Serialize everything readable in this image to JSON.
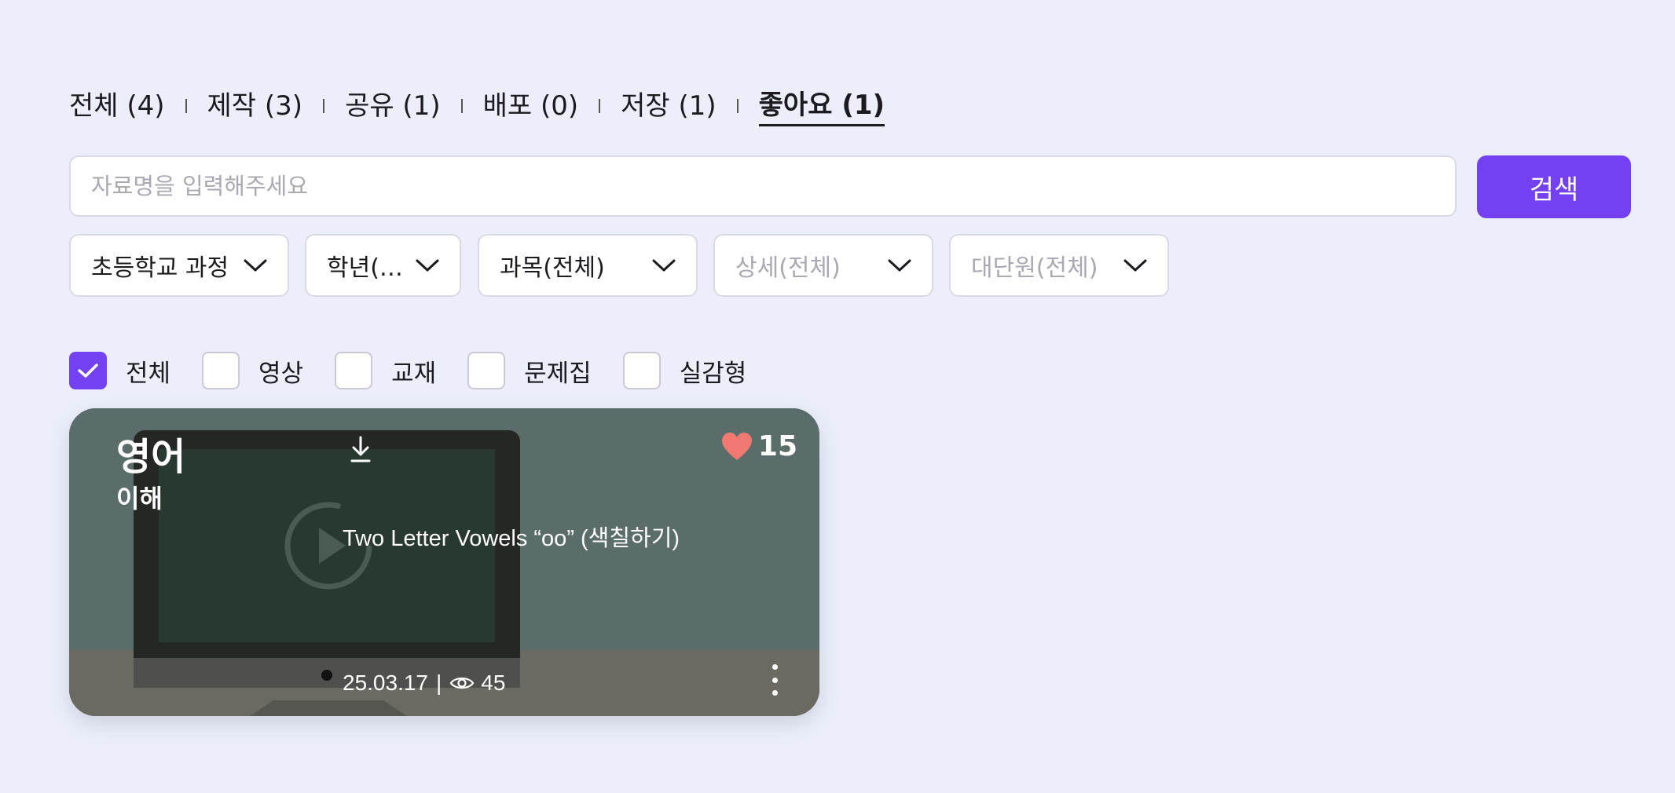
{
  "tabs": [
    {
      "label": "전체 (4)",
      "active": false
    },
    {
      "label": "제작 (3)",
      "active": false
    },
    {
      "label": "공유 (1)",
      "active": false
    },
    {
      "label": "배포 (0)",
      "active": false
    },
    {
      "label": "저장 (1)",
      "active": false
    },
    {
      "label": "좋아요 (1)",
      "active": true
    }
  ],
  "search": {
    "placeholder": "자료명을 입력해주세요",
    "value": "",
    "button_label": "검색"
  },
  "filters": {
    "course": "초등학교 과정",
    "grade": "학년(…",
    "subject": "과목(전체)",
    "detail": "상세(전체)",
    "unit": "대단원(전체)"
  },
  "checkboxes": [
    {
      "label": "전체",
      "checked": true
    },
    {
      "label": "영상",
      "checked": false
    },
    {
      "label": "교재",
      "checked": false
    },
    {
      "label": "문제집",
      "checked": false
    },
    {
      "label": "실감형",
      "checked": false
    }
  ],
  "card": {
    "subject": "영어",
    "topic": "이해",
    "likes": "15",
    "title": "Two Letter Vowels “oo” (색칠하기)",
    "date": "25.03.17",
    "separator": "|",
    "views": "45",
    "icons": [
      "download-icon",
      "heart-icon",
      "eye-icon",
      "more-vertical-icon",
      "play-icon"
    ]
  },
  "colors": {
    "background": "#eceffb",
    "accent": "#7341f2",
    "heart": "#f07a72",
    "card_overlay": "#5a6b68"
  }
}
